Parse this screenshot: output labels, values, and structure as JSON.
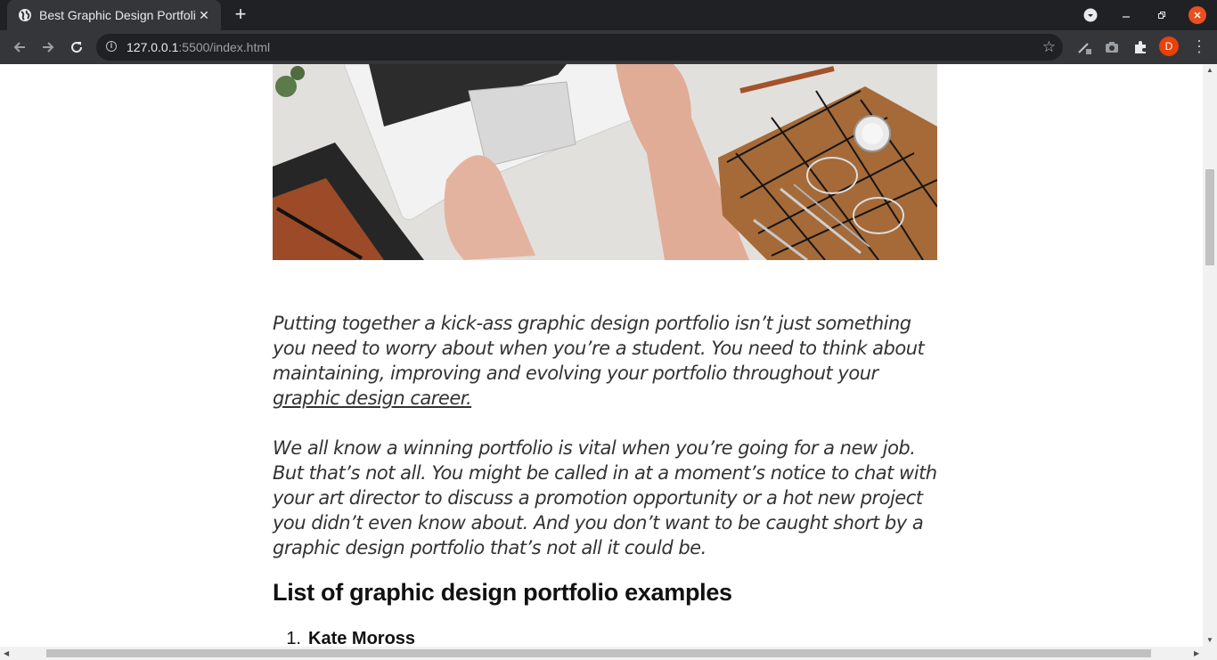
{
  "browser": {
    "tab_title": "Best Graphic Design Portfolio",
    "tab_close": "✕",
    "new_tab": "+",
    "url_host": "127.0.0.1",
    "url_rest": ":5500/index.html",
    "avatar_letter": "D"
  },
  "article": {
    "para1_text": "Putting together a kick-ass graphic design portfolio isn’t just something you need to worry about when you’re a student. You need to think about maintaining, improving and evolving your portfolio throughout your ",
    "para1_link": "graphic design career.",
    "para2_text": "We all know a winning portfolio is vital when you’re going for a new job. But that’s not all. You might be called in at a moment’s notice to chat with your art director to discuss a promotion opportunity or a hot new project you didn’t even know about. And you don’t want to be caught short by a graphic design portfolio that’s not all it could be.",
    "heading": "List of graphic design portfolio examples",
    "list": [
      {
        "num": "1.",
        "name": "Kate Moross"
      }
    ]
  },
  "colors": {
    "tabbar": "#202124",
    "toolbar": "#35363a",
    "avatar": "#e8410a",
    "close_button": "#e94f1f"
  }
}
